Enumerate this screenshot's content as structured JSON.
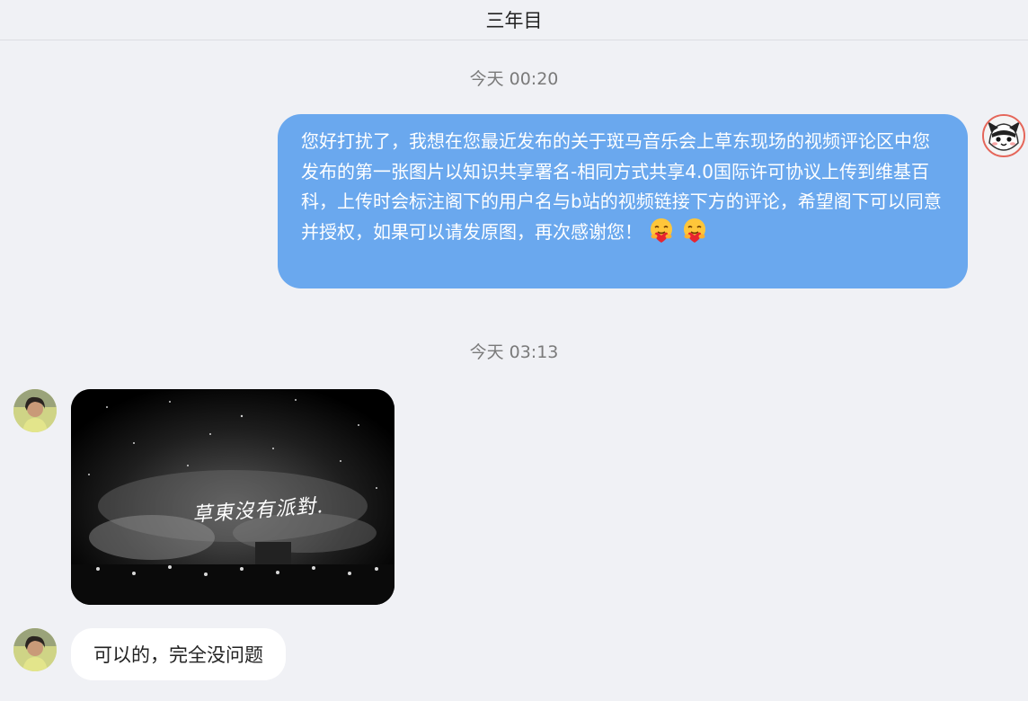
{
  "header": {
    "title": "三年目"
  },
  "messages": [
    {
      "timestamp": "今天 00:20",
      "sender": "me",
      "text": "您好打扰了，我想在您最近发布的关于斑马音乐会上草东现场的视频评论区中您发布的第一张图片以知识共享署名-相同方式共享4.0国际许可协议上传到维基百科，上传时会标注阁下的用户名与b站的视频链接下方的评论，希望阁下可以同意并授权，如果可以请发原图，再次感谢您！",
      "emojis": [
        "hug-heart-emoji",
        "hug-heart-emoji"
      ]
    },
    {
      "timestamp": "今天 03:13",
      "sender": "other",
      "image_caption": "草東沒有派對."
    },
    {
      "sender": "other",
      "text": "可以的，完全没问题"
    }
  ],
  "colors": {
    "background": "#f0f1f5",
    "my_bubble": "#6aa8ee",
    "other_bubble": "#ffffff",
    "timestamp": "#7a7a7a"
  }
}
